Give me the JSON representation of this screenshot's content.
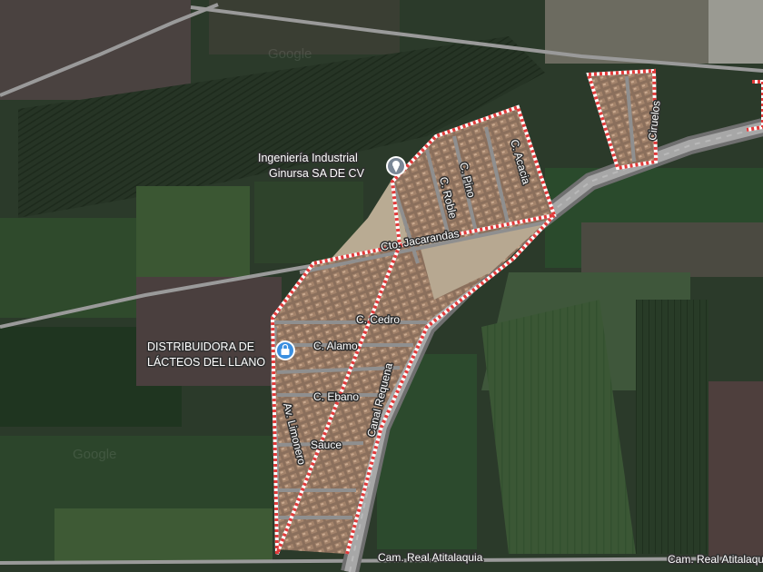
{
  "map": {
    "type": "satellite",
    "watermark": "Google",
    "colors": {
      "boundary": "#e23b3b",
      "road": "#8f8f8f",
      "field_dark": "#263425",
      "field_green": "#35512f",
      "residential": "#8a6f5c"
    }
  },
  "streets": {
    "ciruelos": "Ciruelos",
    "acacia": "C. Acacia",
    "pino": "C. Pino",
    "roble": "C. Roble",
    "jacarandas": "Cto. Jacarandas",
    "cedro": "C. Cedro",
    "alamo": "C. Alamo",
    "ebano": "C. Ebano",
    "sauce": "Sauce",
    "limonero": "Av. Limonero",
    "canal": "Canal Requena",
    "camino_left": "Cam. Real Atitalaquia",
    "camino_right": "Cam. Real Atitalaquia"
  },
  "pois": {
    "ginursa": {
      "line1": "Ingeniería Industrial",
      "line2": "Ginursa SA DE CV",
      "icon": "place-pin-icon"
    },
    "lacteos": {
      "line1": "DISTRIBUIDORA DE",
      "line2": "LÁCTEOS DEL LLANO",
      "icon": "shopping-bag-pin-icon"
    }
  }
}
